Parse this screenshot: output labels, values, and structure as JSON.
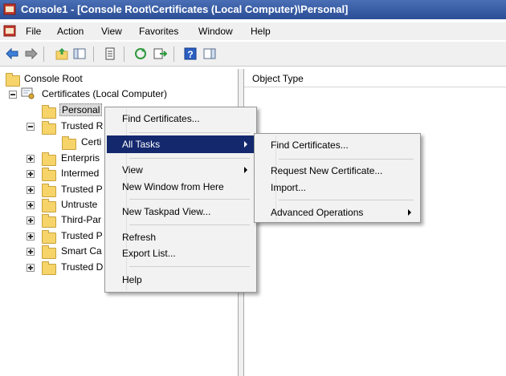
{
  "window": {
    "title": "Console1 - [Console Root\\Certificates (Local Computer)\\Personal]"
  },
  "menubar": {
    "items": [
      "File",
      "Action",
      "View",
      "Favorites",
      "Window",
      "Help"
    ]
  },
  "toolbar": {
    "buttons": [
      "back-icon",
      "forward-icon",
      "up-folder-icon",
      "show-hide-tree-icon",
      "properties-icon",
      "refresh-icon",
      "export-list-icon",
      "help-icon",
      "action-pane-icon"
    ]
  },
  "tree": {
    "root": "Console Root",
    "certificates": "Certificates (Local Computer)",
    "personal": "Personal",
    "trusted_root": "Trusted R",
    "certificates_child": "Certi",
    "enterprise": "Enterpris",
    "intermediate": "Intermed",
    "trusted_publishers": "Trusted P",
    "untrusted": "Untruste",
    "third_party": "Third-Par",
    "trusted_people": "Trusted P",
    "smart_card": "Smart Ca",
    "trusted_devices": "Trusted D"
  },
  "right_pane": {
    "column_header": "Object Type"
  },
  "context_menu": {
    "find_certificates": "Find Certificates...",
    "all_tasks": "All Tasks",
    "view": "View",
    "new_window": "New Window from Here",
    "new_taskpad": "New Taskpad View...",
    "refresh": "Refresh",
    "export_list": "Export List...",
    "help": "Help"
  },
  "submenu": {
    "find_certificates": "Find Certificates...",
    "request_new": "Request New Certificate...",
    "import": "Import...",
    "advanced": "Advanced Operations"
  },
  "colors": {
    "titlebar": "#2b4e96",
    "menu_highlight": "#14286e",
    "folder": "#f6d46a"
  }
}
